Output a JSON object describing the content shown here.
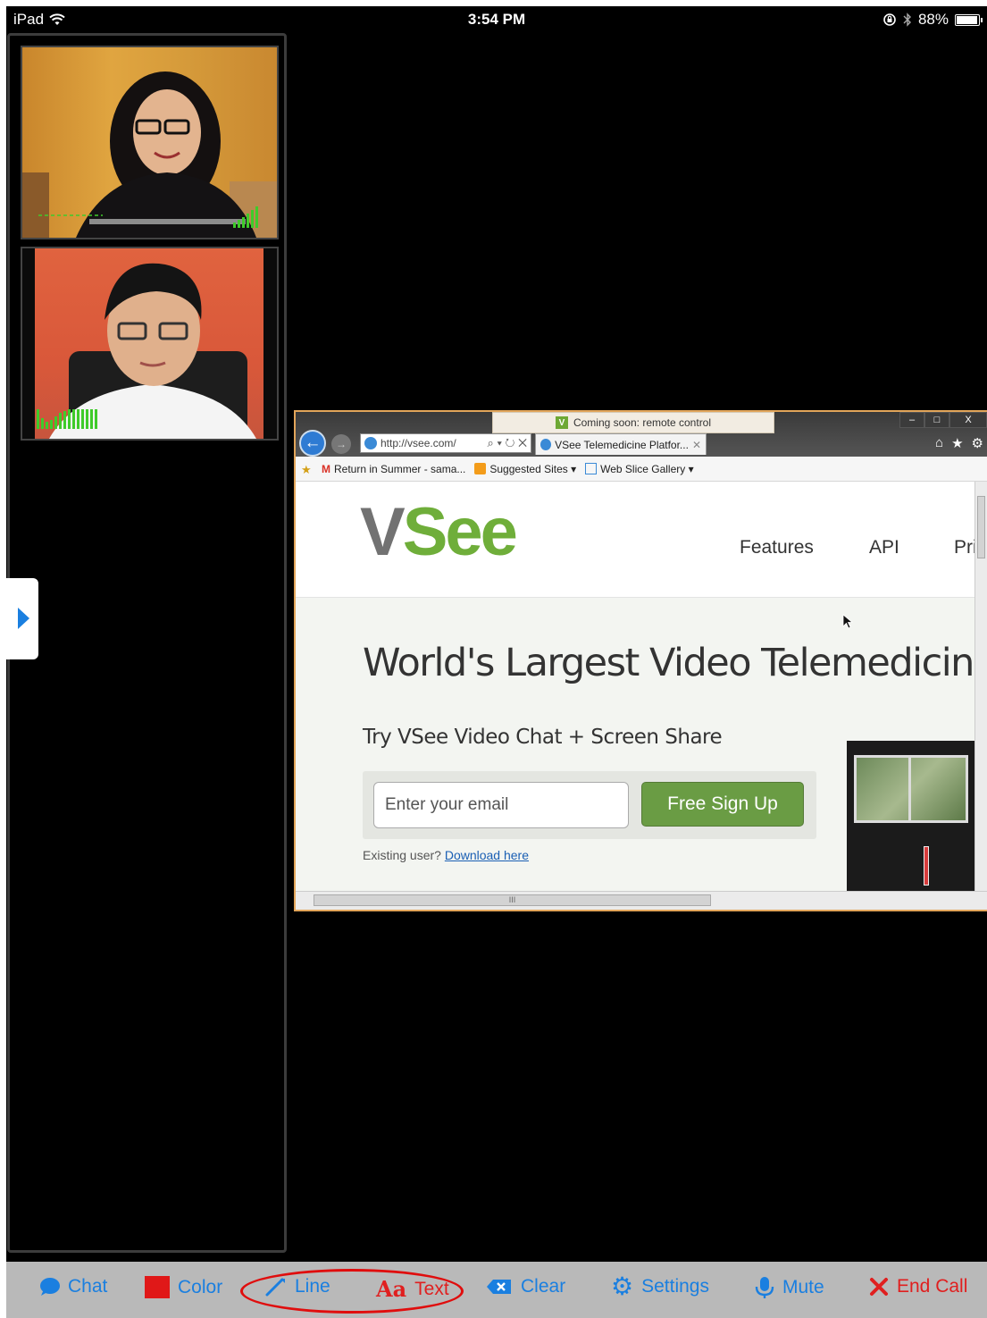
{
  "status": {
    "device": "iPad",
    "time": "3:54 PM",
    "battery": "88%",
    "battery_level": 0.88
  },
  "browser": {
    "notice": "Coming soon: remote control",
    "url": "http://vsee.com/",
    "url_controls": "⌕ ▾ ↻ ✕",
    "tab_title": "VSee Telemedicine Platfor...",
    "tab_close": "✕",
    "window_buttons": {
      "minimize": "–",
      "maximize": "□",
      "close": "X"
    },
    "favorites": [
      {
        "label": "Return in Summer - sama..."
      },
      {
        "label": "Suggested Sites ▾"
      },
      {
        "label": "Web Slice Gallery ▾"
      }
    ],
    "page": {
      "logo_v": "V",
      "logo_rest": "See",
      "nav": [
        "Features",
        "API",
        "Pri"
      ],
      "headline": "World's Largest Video Telemedicine",
      "subhead": "Try VSee Video Chat + Screen Share",
      "email_placeholder": "Enter your email",
      "signup_button": "Free Sign Up",
      "existing_text": "Existing user?",
      "download_link": "Download here"
    },
    "hscroll_grip": "III"
  },
  "toolbar": {
    "chat": "Chat",
    "color": "Color",
    "line": "Line",
    "text": "Text",
    "text_icon": "Aa",
    "clear": "Clear",
    "settings": "Settings",
    "mute": "Mute",
    "end_call": "End Call"
  },
  "colors": {
    "accent": "#1a7fe0",
    "danger": "#e01f1f",
    "brand_green": "#6fae3a",
    "toolbar_bg": "#b9b9b9"
  }
}
